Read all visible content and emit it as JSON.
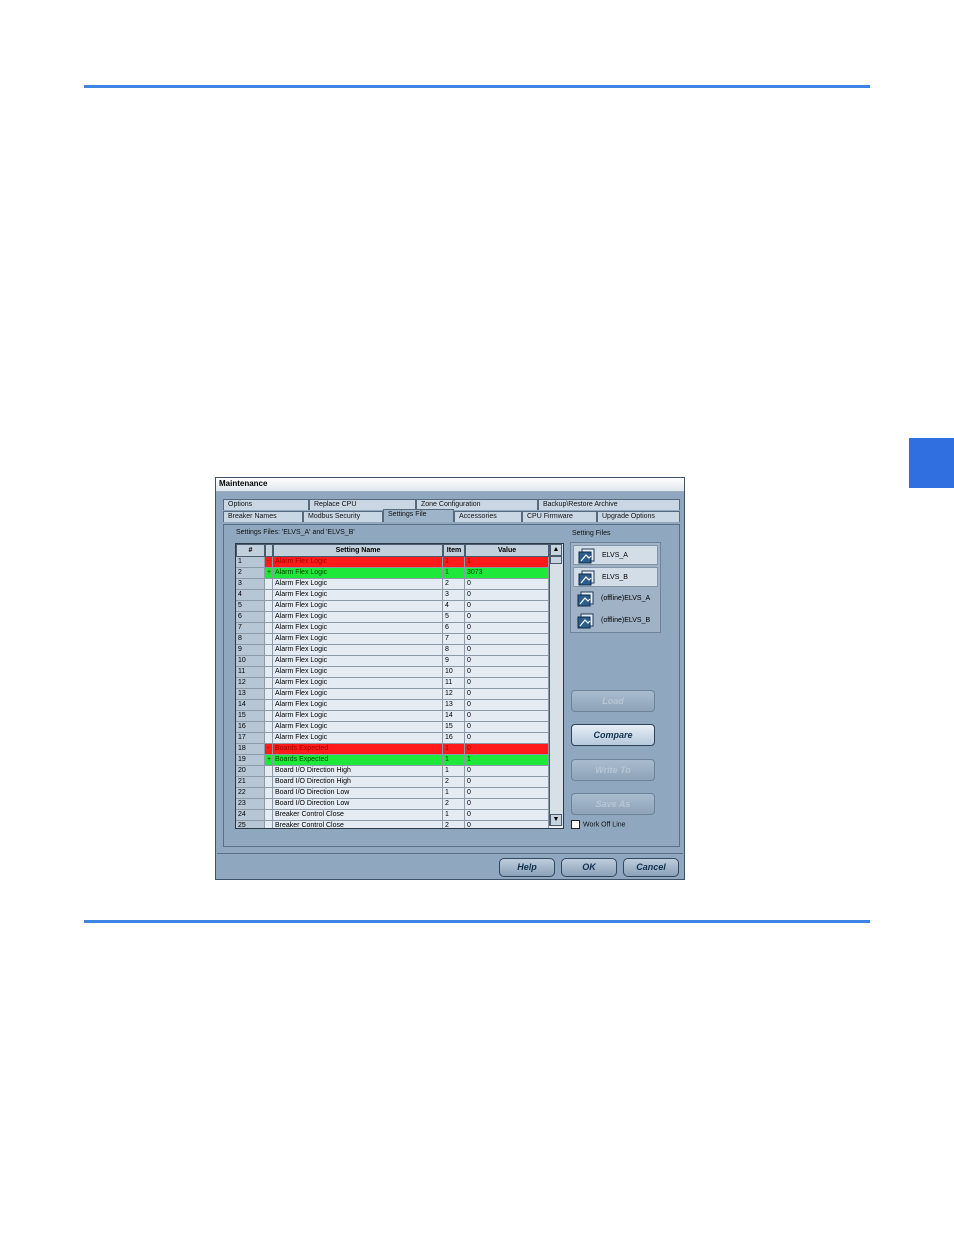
{
  "window": {
    "title": "Maintenance"
  },
  "tabs": {
    "row1": [
      "Options",
      "Replace CPU",
      "Zone Configuration",
      "Backup\\Restore Archive"
    ],
    "row2": [
      "Breaker Names",
      "Modbus Security",
      "Settings File",
      "Accessories",
      "CPU Firmware",
      "Upgrade Options"
    ],
    "active": "Settings File"
  },
  "settings_files_label": "Settings Files: 'ELVS_A' and 'ELVS_B'",
  "grid": {
    "headers": [
      "#",
      "Setting Name",
      "Item",
      "Value"
    ],
    "rows": [
      {
        "n": "1",
        "mark": "-",
        "name": "Alarm Flex Logic",
        "item": "1",
        "value": "1",
        "status": "removed"
      },
      {
        "n": "2",
        "mark": "+",
        "name": "Alarm Flex Logic",
        "item": "1",
        "value": "3073",
        "status": "added"
      },
      {
        "n": "3",
        "mark": "",
        "name": "Alarm Flex Logic",
        "item": "2",
        "value": "0",
        "status": ""
      },
      {
        "n": "4",
        "mark": "",
        "name": "Alarm Flex Logic",
        "item": "3",
        "value": "0",
        "status": ""
      },
      {
        "n": "5",
        "mark": "",
        "name": "Alarm Flex Logic",
        "item": "4",
        "value": "0",
        "status": ""
      },
      {
        "n": "6",
        "mark": "",
        "name": "Alarm Flex Logic",
        "item": "5",
        "value": "0",
        "status": ""
      },
      {
        "n": "7",
        "mark": "",
        "name": "Alarm Flex Logic",
        "item": "6",
        "value": "0",
        "status": ""
      },
      {
        "n": "8",
        "mark": "",
        "name": "Alarm Flex Logic",
        "item": "7",
        "value": "0",
        "status": ""
      },
      {
        "n": "9",
        "mark": "",
        "name": "Alarm Flex Logic",
        "item": "8",
        "value": "0",
        "status": ""
      },
      {
        "n": "10",
        "mark": "",
        "name": "Alarm Flex Logic",
        "item": "9",
        "value": "0",
        "status": ""
      },
      {
        "n": "11",
        "mark": "",
        "name": "Alarm Flex Logic",
        "item": "10",
        "value": "0",
        "status": ""
      },
      {
        "n": "12",
        "mark": "",
        "name": "Alarm Flex Logic",
        "item": "11",
        "value": "0",
        "status": ""
      },
      {
        "n": "13",
        "mark": "",
        "name": "Alarm Flex Logic",
        "item": "12",
        "value": "0",
        "status": ""
      },
      {
        "n": "14",
        "mark": "",
        "name": "Alarm Flex Logic",
        "item": "13",
        "value": "0",
        "status": ""
      },
      {
        "n": "15",
        "mark": "",
        "name": "Alarm Flex Logic",
        "item": "14",
        "value": "0",
        "status": ""
      },
      {
        "n": "16",
        "mark": "",
        "name": "Alarm Flex Logic",
        "item": "15",
        "value": "0",
        "status": ""
      },
      {
        "n": "17",
        "mark": "",
        "name": "Alarm Flex Logic",
        "item": "16",
        "value": "0",
        "status": ""
      },
      {
        "n": "18",
        "mark": "-",
        "name": "Boards Expected",
        "item": "1",
        "value": "0",
        "status": "removed"
      },
      {
        "n": "19",
        "mark": "+",
        "name": "Boards Expected",
        "item": "1",
        "value": "1",
        "status": "added"
      },
      {
        "n": "20",
        "mark": "",
        "name": "Board I/O Direction High",
        "item": "1",
        "value": "0",
        "status": ""
      },
      {
        "n": "21",
        "mark": "",
        "name": "Board I/O Direction High",
        "item": "2",
        "value": "0",
        "status": ""
      },
      {
        "n": "22",
        "mark": "",
        "name": "Board I/O Direction Low",
        "item": "1",
        "value": "0",
        "status": ""
      },
      {
        "n": "23",
        "mark": "",
        "name": "Board I/O Direction Low",
        "item": "2",
        "value": "0",
        "status": ""
      },
      {
        "n": "24",
        "mark": "",
        "name": "Breaker Control Close",
        "item": "1",
        "value": "0",
        "status": ""
      },
      {
        "n": "25",
        "mark": "",
        "name": "Breaker Control Close",
        "item": "2",
        "value": "0",
        "status": ""
      }
    ]
  },
  "setting_files": {
    "label": "Setting Files",
    "items": [
      {
        "label": "ELVS_A",
        "selected": true
      },
      {
        "label": "ELVS_B",
        "selected": true
      },
      {
        "label": "(offline)ELVS_A",
        "selected": false
      },
      {
        "label": "(offline)ELVS_B",
        "selected": false
      }
    ]
  },
  "buttons": {
    "load": "Load",
    "compare": "Compare",
    "write_to": "Write To",
    "save_as": "Save As",
    "work_off_line": "Work Off Line",
    "help": "Help",
    "ok": "OK",
    "cancel": "Cancel"
  },
  "scroll": {
    "up": "▲",
    "down": "▼"
  },
  "colors": {
    "accent_rule": "#3b86e2",
    "side_tab": "#2f6fe0",
    "removed_row": "#ff1b1b",
    "added_row": "#1ee83a"
  }
}
